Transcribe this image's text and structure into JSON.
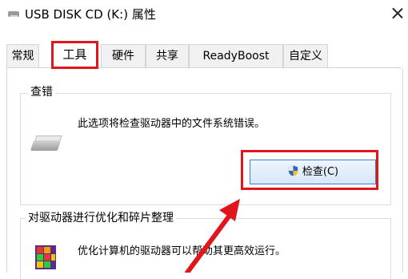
{
  "window": {
    "title": "USB DISK CD (K:) 属性",
    "close_label": "×"
  },
  "tabs": [
    {
      "label": "常规"
    },
    {
      "label": "工具"
    },
    {
      "label": "硬件"
    },
    {
      "label": "共享"
    },
    {
      "label": "ReadyBoost"
    },
    {
      "label": "自定义"
    }
  ],
  "active_tab": "工具",
  "error_check": {
    "group_title": "查错",
    "description": "此选项将检查驱动器中的文件系统错误。",
    "button_label": "检查(C)"
  },
  "optimize": {
    "group_title": "对驱动器进行优化和碎片整理",
    "description": "优化计算机的驱动器可以帮助其更高效运行。"
  },
  "colors": {
    "highlight": "#e0161c",
    "button_border": "#3f7fd3"
  }
}
